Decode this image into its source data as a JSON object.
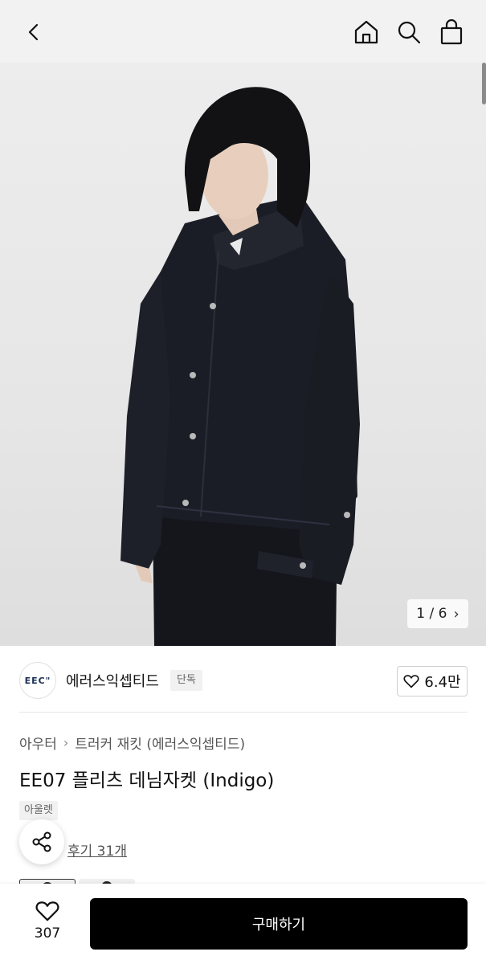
{
  "header": {
    "back_icon": "chevron-left-icon",
    "home_icon": "home-icon",
    "search_icon": "search-icon",
    "cart_icon": "shopping-bag-icon"
  },
  "gallery": {
    "counter_current": "1",
    "counter_separator": "/",
    "counter_total": "6"
  },
  "brand": {
    "logo_text": "EEC\"",
    "name": "에러스익셉티드",
    "exclusive_badge": "단독",
    "likes": "6.4만"
  },
  "breadcrumb": {
    "category": "아우터",
    "subcategory": "트러커 재킷 (에러스익셉티드)"
  },
  "product": {
    "title": "EE07 플리츠 데님자켓 (Indigo)",
    "outlet_badge": "아울렛",
    "reviews": "후기 31개"
  },
  "bottom_bar": {
    "wish_count": "307",
    "buy_label": "구매하기"
  },
  "colors": {
    "jacket": "#1b1d26",
    "background": "#e9e9e9",
    "buy_button": "#000000"
  }
}
